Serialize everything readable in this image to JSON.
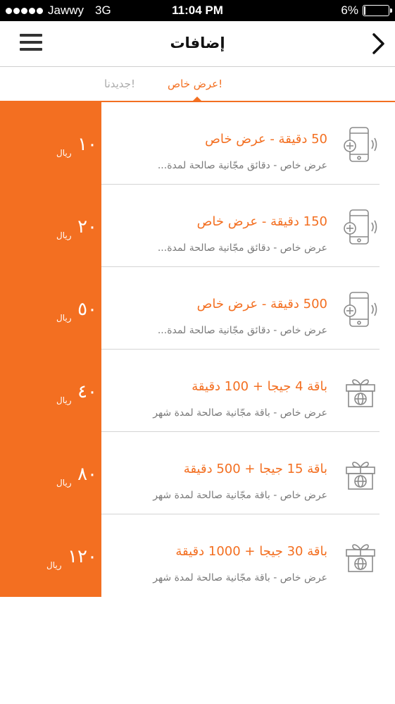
{
  "status_bar": {
    "carrier": "Jawwy",
    "network": "3G",
    "time": "11:04 PM",
    "battery_text": "6%",
    "battery_level": 0.06
  },
  "header": {
    "title": "إضافات"
  },
  "tabs": [
    {
      "label": "عرض خاص!",
      "active": true
    },
    {
      "label": "جديدنا!",
      "active": false
    }
  ],
  "offers": [
    {
      "icon": "phone-plus-icon",
      "title": "50 دقيقة - عرض خاص",
      "subtitle": "عرض خاص - دقائق مجّانية صالحة لمدة...",
      "price": "١٠",
      "currency": "ريال"
    },
    {
      "icon": "phone-plus-icon",
      "title": "150 دقيقة - عرض خاص",
      "subtitle": "عرض خاص - دقائق مجّانية صالحة لمدة...",
      "price": "٢٠",
      "currency": "ريال"
    },
    {
      "icon": "phone-plus-icon",
      "title": "500 دقيقة - عرض خاص",
      "subtitle": "عرض خاص - دقائق مجّانية صالحة لمدة...",
      "price": "٥٠",
      "currency": "ريال"
    },
    {
      "icon": "gift-globe-icon",
      "title": "باقة 4 جيجا + 100 دقيقة",
      "subtitle": "عرض خاص - باقة مجّانية صالحة لمدة شهر",
      "price": "٤٠",
      "currency": "ريال"
    },
    {
      "icon": "gift-globe-icon",
      "title": "باقة 15 جيجا + 500 دقيقة",
      "subtitle": "عرض خاص - باقة مجّانية صالحة لمدة شهر",
      "price": "٨٠",
      "currency": "ريال"
    },
    {
      "icon": "gift-globe-icon",
      "title": "باقة 30 جيجا + 1000 دقيقة",
      "subtitle": "عرض خاص - باقة مجّانية صالحة لمدة شهر",
      "price": "١٢٠",
      "currency": "ريال"
    }
  ],
  "colors": {
    "accent": "#f36f21",
    "text_muted": "#7a7a7a"
  }
}
